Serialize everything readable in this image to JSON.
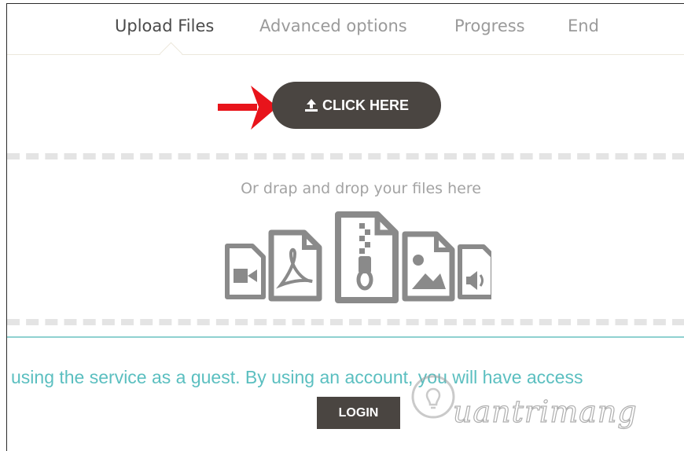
{
  "tabs": [
    {
      "label": "Upload Files",
      "active": true
    },
    {
      "label": "Advanced options",
      "active": false
    },
    {
      "label": "Progress",
      "active": false
    },
    {
      "label": "End",
      "active": false
    }
  ],
  "upload": {
    "button_label": "CLICK HERE",
    "button_icon": "upload-icon",
    "drop_text": "Or drap and drop your files here",
    "file_type_icons": [
      "video-file-icon",
      "pdf-file-icon",
      "zip-file-icon",
      "image-file-icon",
      "audio-file-icon"
    ]
  },
  "guest": {
    "message": "ly using the service as a guest. By using an account, you will have access",
    "login_label": "LOGIN"
  },
  "watermark": {
    "text": "uantrimang"
  },
  "colors": {
    "button_bg": "#4a4541",
    "teal_text": "#5bbfc0",
    "annotation_arrow": "#e8141b",
    "dash": "#e4e4e4"
  }
}
